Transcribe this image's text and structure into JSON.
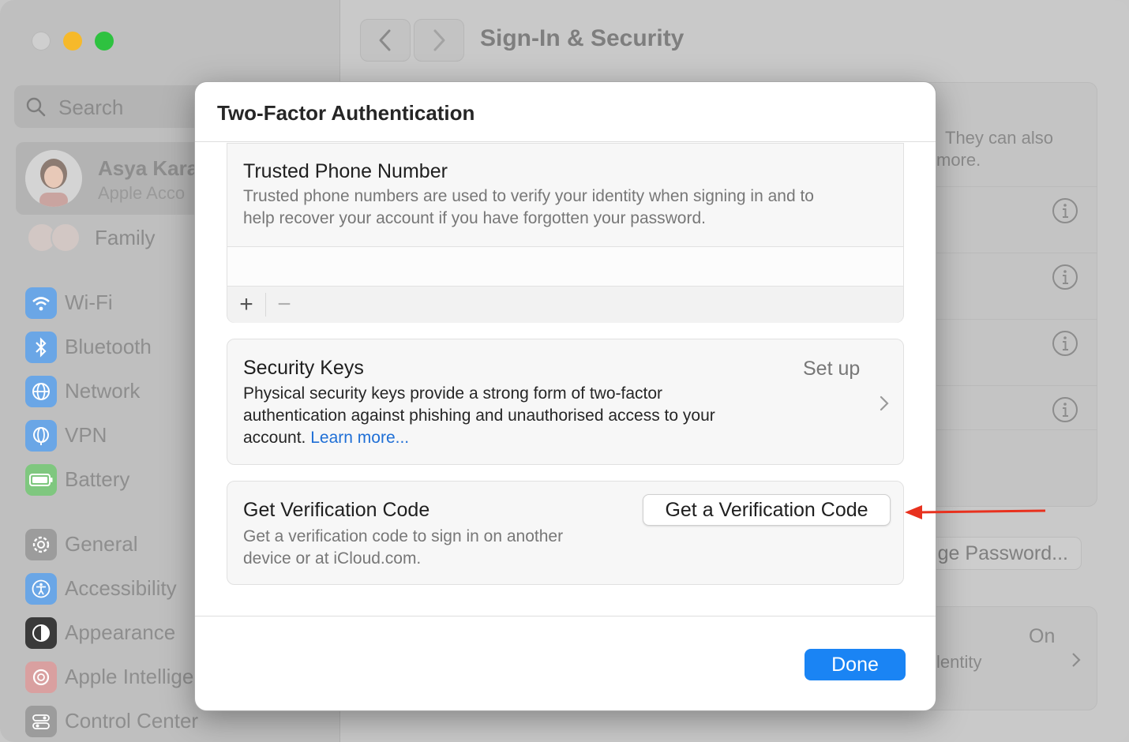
{
  "window": {
    "title": "Sign-In & Security"
  },
  "sidebar": {
    "search_placeholder": "Search",
    "account": {
      "name": "Asya Kara",
      "subtitle": "Apple Acco"
    },
    "family_label": "Family",
    "items": [
      {
        "label": "Wi-Fi",
        "icon": "wifi-icon",
        "color": "#6aa6e6"
      },
      {
        "label": "Bluetooth",
        "icon": "bluetooth-icon",
        "color": "#6aa6e6"
      },
      {
        "label": "Network",
        "icon": "globe-icon",
        "color": "#6aa6e6"
      },
      {
        "label": "VPN",
        "icon": "vpn-globe-icon",
        "color": "#6aa6e6"
      },
      {
        "label": "Battery",
        "icon": "battery-icon",
        "color": "#7fc77f"
      },
      {
        "label": "General",
        "icon": "gear-icon",
        "color": "#9c9c9c"
      },
      {
        "label": "Accessibility",
        "icon": "accessibility-icon",
        "color": "#6aa6e6"
      },
      {
        "label": "Appearance",
        "icon": "appearance-icon",
        "color": "#3a3a3a"
      },
      {
        "label": "Apple Intellige",
        "icon": "apple-intelligence-icon",
        "color": "#d9a0a0"
      },
      {
        "label": "Control Center",
        "icon": "control-center-icon",
        "color": "#9c9c9c"
      }
    ]
  },
  "background": {
    "panel_text_line1": "They can also",
    "panel_text_line2": "more.",
    "change_password_partial": "ge Password...",
    "setting_value": "On",
    "setting_label_partial": "lentity"
  },
  "modal": {
    "title": "Two-Factor Authentication",
    "trusted_phone": {
      "title": "Trusted Phone Number",
      "description_line1": "Trusted phone numbers are used to verify your identity when signing in and to",
      "description_line2": "help recover your account if you have forgotten your password.",
      "add_label": "+",
      "remove_label": "−"
    },
    "security_keys": {
      "title": "Security Keys",
      "action": "Set up",
      "description_line1": "Physical security keys provide a strong form of two-factor",
      "description_line2": "authentication against phishing and unauthorised access to your",
      "description_line3": "account.",
      "learn_more": "Learn more..."
    },
    "verification": {
      "title": "Get Verification Code",
      "description_line1": "Get a verification code to sign in on another",
      "description_line2": "device or at iCloud.com.",
      "button_label": "Get a Verification Code"
    },
    "done_label": "Done"
  },
  "colors": {
    "accent": "#1a84f4",
    "link": "#1f6fd6",
    "arrow": "#e8311e"
  }
}
